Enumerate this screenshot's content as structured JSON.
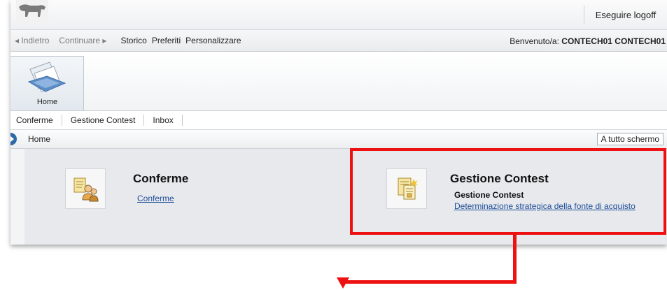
{
  "topbar": {
    "logoff_label": "Eseguire logoff"
  },
  "nav": {
    "back": "◂ Indietro",
    "forward": "Continuare ▸",
    "links": [
      "Storico",
      "Preferiti",
      "Personalizzare"
    ],
    "welcome_prefix": "Benvenuto/a:",
    "welcome_user": "CONTECH01 CONTECH01"
  },
  "ribbon": {
    "home_label": "Home"
  },
  "subtabs": [
    "Conferme",
    "Gestione Contest",
    "Inbox"
  ],
  "breadcrumb": {
    "current": "Home",
    "fullscreen_label": "A tutto schermo"
  },
  "tiles": [
    {
      "title": "Conferme",
      "link": "Conferme"
    },
    {
      "title": "Gestione Contest",
      "subtitle": "Gestione Contest",
      "link": "Determinazione strategica della fonte di acquisto"
    }
  ],
  "colors": {
    "annotation": "#ee1111",
    "link": "#1f4e9a",
    "nav_handle": "#2e6aa5"
  },
  "icons": [
    "dog-logo-icon",
    "home-documents-icon",
    "confirm-people-icon",
    "contest-document-icon",
    "chevron-right-icon"
  ]
}
